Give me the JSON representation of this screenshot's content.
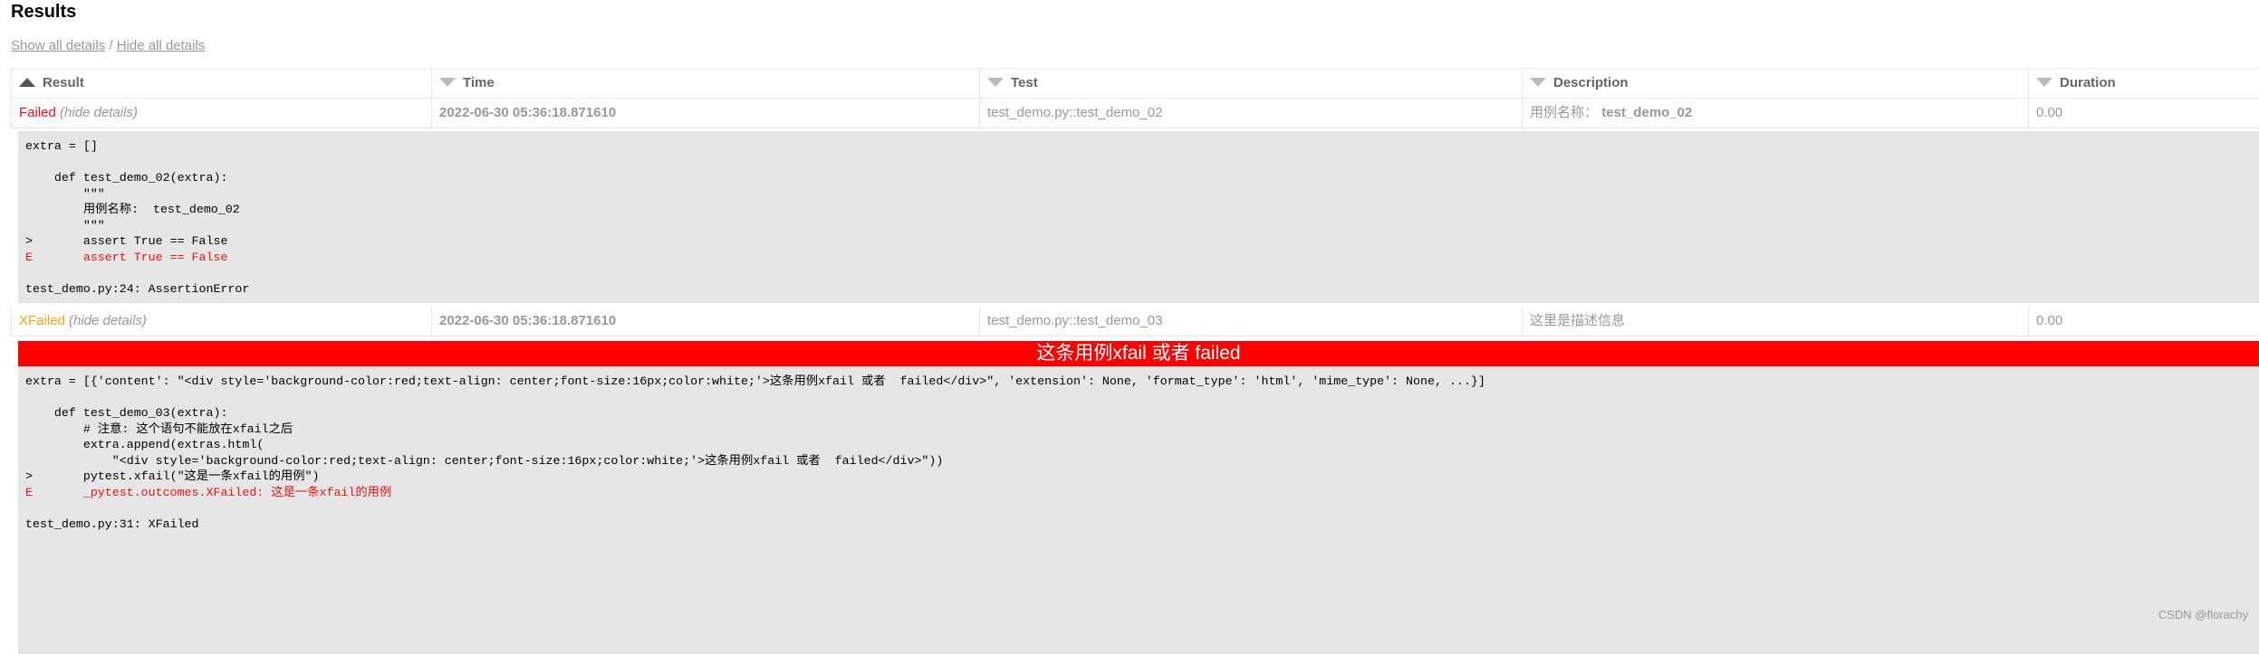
{
  "page": {
    "heading": "Results",
    "show_all": "Show all details",
    "separator": "/",
    "hide_all": "Hide all details"
  },
  "table": {
    "columns": [
      "Result",
      "Time",
      "Test",
      "Description",
      "Duration"
    ],
    "rows": [
      {
        "result": "Failed",
        "hide": "(hide details)",
        "time": "2022-06-30 05:36:18.871610",
        "test": "test_demo.py::test_demo_02",
        "description_label": "用例名称：",
        "description_value": "test_demo_02",
        "duration": "0.00"
      },
      {
        "result": "XFailed",
        "hide": "(hide details)",
        "time": "2022-06-30 05:36:18.871610",
        "test": "test_demo.py::test_demo_03",
        "description_label": "这里是描述信息",
        "description_value": "",
        "duration": "0.00"
      }
    ]
  },
  "log1": [
    "extra = []",
    "",
    "    def test_demo_02(extra):",
    "        \"\"\"",
    "        用例名称:  test_demo_02",
    "        \"\"\"",
    ">       assert True == False",
    "E       assert True == False",
    "",
    "test_demo.py:24: AssertionError"
  ],
  "banner": "这条用例xfail 或者 failed",
  "log2": [
    "extra = [{'content': \"<div style='background-color:red;text-align: center;font-size:16px;color:white;'>这条用例xfail 或者  failed</div>\", 'extension': None, 'format_type': 'html', 'mime_type': None, ...}]",
    "",
    "    def test_demo_03(extra):",
    "        # 注意: 这个语句不能放在xfail之后",
    "        extra.append(extras.html(",
    "            \"<div style='background-color:red;text-align: center;font-size:16px;color:white;'>这条用例xfail 或者  failed</div>\"))",
    ">       pytest.xfail(\"这是一条xfail的用例\")",
    "E       _pytest.outcomes.XFailed: 这是一条xfail的用例",
    "",
    "test_demo.py:31: XFailed"
  ],
  "watermark": "CSDN @florachy",
  "colors": {
    "failed": "#ee1111",
    "xfailed": "#f7a31e",
    "banner": "#ff0000",
    "panel": "#e6e6e6"
  }
}
